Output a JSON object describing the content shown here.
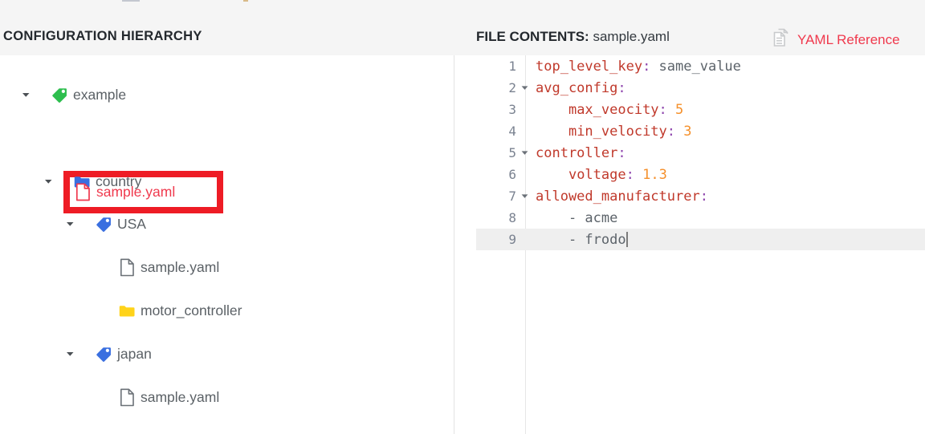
{
  "panels": {
    "hierarchy": {
      "title": "CONFIGURATION HIERARCHY",
      "tree": [
        {
          "label": "example",
          "icon": "tag-green-icon",
          "caret": "chevron-down-icon",
          "depth": 0
        },
        {
          "label": "sample.yaml",
          "icon": "file-red-icon",
          "caret": "",
          "depth": 1,
          "selected": true
        },
        {
          "label": "country",
          "icon": "folder-blue-icon",
          "caret": "chevron-down-icon",
          "depth": 1
        },
        {
          "label": "USA",
          "icon": "tag-blue-icon",
          "caret": "chevron-down-icon",
          "depth": 2
        },
        {
          "label": "sample.yaml",
          "icon": "file-gray-icon",
          "caret": "",
          "depth": 3
        },
        {
          "label": "motor_controller",
          "icon": "folder-yellow-icon",
          "caret": "",
          "depth": 3
        },
        {
          "label": "japan",
          "icon": "tag-blue-icon",
          "caret": "chevron-down-icon",
          "depth": 2
        },
        {
          "label": "sample.yaml",
          "icon": "file-gray-icon",
          "caret": "",
          "depth": 3
        }
      ]
    },
    "file_contents": {
      "label": "FILE CONTENTS:",
      "filename": "sample.yaml",
      "reference_link": {
        "label": "YAML Reference",
        "icon": "document-copy-icon",
        "color": "#f0394d"
      },
      "editor": {
        "active_line": 9,
        "cursor_line": 9,
        "lines": [
          {
            "n": "1",
            "foldable": false,
            "indent": 0,
            "tokens": [
              {
                "t": "top_level_key",
                "c": "key"
              },
              {
                "t": ":",
                "c": "colon"
              },
              {
                "t": " same_value",
                "c": "str"
              }
            ]
          },
          {
            "n": "2",
            "foldable": true,
            "indent": 0,
            "tokens": [
              {
                "t": "avg_config",
                "c": "key"
              },
              {
                "t": ":",
                "c": "colon"
              }
            ]
          },
          {
            "n": "3",
            "foldable": false,
            "indent": 4,
            "tokens": [
              {
                "t": "max_veocity",
                "c": "key"
              },
              {
                "t": ":",
                "c": "colon"
              },
              {
                "t": " 5",
                "c": "num"
              }
            ]
          },
          {
            "n": "4",
            "foldable": false,
            "indent": 4,
            "tokens": [
              {
                "t": "min_velocity",
                "c": "key"
              },
              {
                "t": ":",
                "c": "colon"
              },
              {
                "t": " 3",
                "c": "num"
              }
            ]
          },
          {
            "n": "5",
            "foldable": true,
            "indent": 0,
            "tokens": [
              {
                "t": "controller",
                "c": "key"
              },
              {
                "t": ":",
                "c": "colon"
              }
            ]
          },
          {
            "n": "6",
            "foldable": false,
            "indent": 4,
            "tokens": [
              {
                "t": "voltage",
                "c": "key"
              },
              {
                "t": ":",
                "c": "colon"
              },
              {
                "t": " 1.3",
                "c": "num"
              }
            ]
          },
          {
            "n": "7",
            "foldable": true,
            "indent": 0,
            "tokens": [
              {
                "t": "allowed_manufacturer",
                "c": "key"
              },
              {
                "t": ":",
                "c": "colon"
              }
            ]
          },
          {
            "n": "8",
            "foldable": false,
            "indent": 4,
            "tokens": [
              {
                "t": "- acme",
                "c": "dash"
              }
            ]
          },
          {
            "n": "9",
            "foldable": false,
            "indent": 4,
            "tokens": [
              {
                "t": "- frodo",
                "c": "dash"
              }
            ]
          }
        ]
      }
    }
  },
  "colors": {
    "accent_red": "#f0394d",
    "annotation_red": "#ee1c25",
    "tag_green": "#2dbe4e",
    "tag_blue": "#3a6fe0",
    "folder_blue": "#3a6fe0",
    "folder_yellow": "#ffd31a",
    "yaml_key": "#c0392b",
    "yaml_colon": "#8e44ad",
    "yaml_number": "#f5902b",
    "yaml_string": "#5c636a"
  }
}
